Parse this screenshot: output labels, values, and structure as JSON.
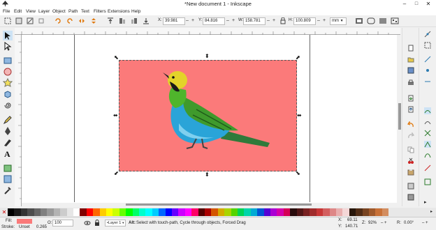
{
  "window": {
    "title": "*New document 1 - Inkscape",
    "minimize": "–",
    "maximize": "□",
    "close": "✕"
  },
  "menu": [
    "File",
    "Edit",
    "View",
    "Layer",
    "Object",
    "Path",
    "Text",
    "Filters",
    "Extensions",
    "Help"
  ],
  "toolbar": {
    "x_label": "X:",
    "x_value": "39.981",
    "y_label": "Y:",
    "y_value": "84.816",
    "w_label": "W:",
    "w_value": "158.781",
    "h_label": "H:",
    "h_value": "100.809",
    "units": "mm"
  },
  "colors": {
    "rect_fill": "#fb7a7a",
    "fill_swatch": "#fb7a7a"
  },
  "status": {
    "fill_label": "Fill:",
    "stroke_label": "Stroke:",
    "stroke_value": "Unset",
    "stroke_width": "0.265",
    "opacity_label": "O:",
    "opacity_value": "100",
    "layer": "•Layer 1",
    "message_bold": "Alt:",
    "message": "Select with touch-path, Cycle through objects, Forced Drag",
    "x_label": "X:",
    "x_value": "69.11",
    "y_label": "Y:",
    "y_value": "140.71",
    "z_label": "Z:",
    "zoom": "92%",
    "r_label": "R:",
    "rotation": "0.00°"
  }
}
